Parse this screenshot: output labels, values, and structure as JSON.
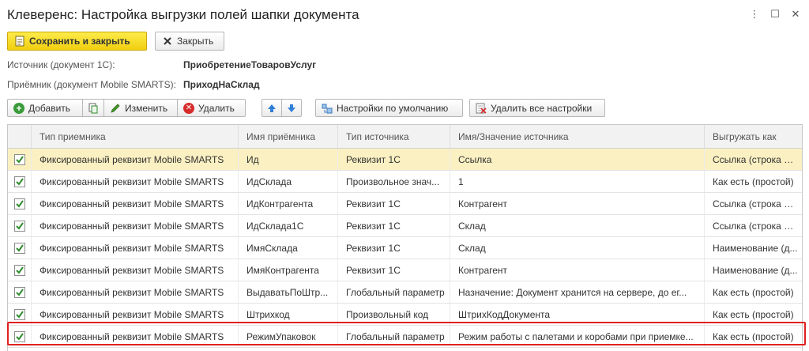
{
  "window": {
    "title": "Клеверенс: Настройка выгрузки полей шапки документа",
    "more_icon": "⋮",
    "maximize_icon": "☐",
    "close_icon": "✕"
  },
  "toolbar": {
    "save_close_label": "Сохранить и закрыть",
    "close_label": "Закрыть"
  },
  "fields": {
    "source_label": "Источник (документ 1С):",
    "source_value": "ПриобретениеТоваровУслуг",
    "receiver_label": "Приёмник (документ Mobile SMARTS):",
    "receiver_value": "ПриходНаСклад"
  },
  "table_toolbar": {
    "add_label": "Добавить",
    "edit_label": "Изменить",
    "delete_label": "Удалить",
    "defaults_label": "Настройки по умолчанию",
    "delete_all_label": "Удалить все настройки"
  },
  "table": {
    "columns": [
      "Тип приемника",
      "Имя приёмника",
      "Тип источника",
      "Имя/Значение источника",
      "Выгружать как"
    ],
    "rows": [
      {
        "checked": true,
        "c1": "Фиксированный реквизит Mobile SMARTS",
        "c2": "Ид",
        "c3": "Реквизит 1С",
        "c4": "Ссылка",
        "c5": "Ссылка (строка G..."
      },
      {
        "checked": true,
        "c1": "Фиксированный реквизит Mobile SMARTS",
        "c2": "ИдСклада",
        "c3": "Произвольное знач...",
        "c4": "1",
        "c5": "Как есть (простой)"
      },
      {
        "checked": true,
        "c1": "Фиксированный реквизит Mobile SMARTS",
        "c2": "ИдКонтрагента",
        "c3": "Реквизит 1С",
        "c4": "Контрагент",
        "c5": "Ссылка (строка G..."
      },
      {
        "checked": true,
        "c1": "Фиксированный реквизит Mobile SMARTS",
        "c2": "ИдСклада1С",
        "c3": "Реквизит 1С",
        "c4": "Склад",
        "c5": "Ссылка (строка G..."
      },
      {
        "checked": true,
        "c1": "Фиксированный реквизит Mobile SMARTS",
        "c2": "ИмяСклада",
        "c3": "Реквизит 1С",
        "c4": "Склад",
        "c5": "Наименование (д..."
      },
      {
        "checked": true,
        "c1": "Фиксированный реквизит Mobile SMARTS",
        "c2": "ИмяКонтрагента",
        "c3": "Реквизит 1С",
        "c4": "Контрагент",
        "c5": "Наименование (д..."
      },
      {
        "checked": true,
        "c1": "Фиксированный реквизит Mobile SMARTS",
        "c2": "ВыдаватьПоШтр...",
        "c3": "Глобальный параметр",
        "c4": "Назначение: Документ хранится на сервере, до ег...",
        "c5": "Как есть (простой)"
      },
      {
        "checked": true,
        "c1": "Фиксированный реквизит Mobile SMARTS",
        "c2": "Штрихкод",
        "c3": "Произвольный код",
        "c4": "ШтрихКодДокумента",
        "c5": "Как есть (простой)"
      },
      {
        "checked": true,
        "c1": "Фиксированный реквизит Mobile SMARTS",
        "c2": "РежимУпаковок",
        "c3": "Глобальный параметр",
        "c4": "Режим работы с палетами и коробами при приемке...",
        "c5": "Как есть (простой)"
      }
    ]
  },
  "colors": {
    "accent_yellow": "#f5d412",
    "selected_row": "#fbf0c2",
    "highlight_border": "#e02020",
    "check_green": "#2e8b2e"
  }
}
